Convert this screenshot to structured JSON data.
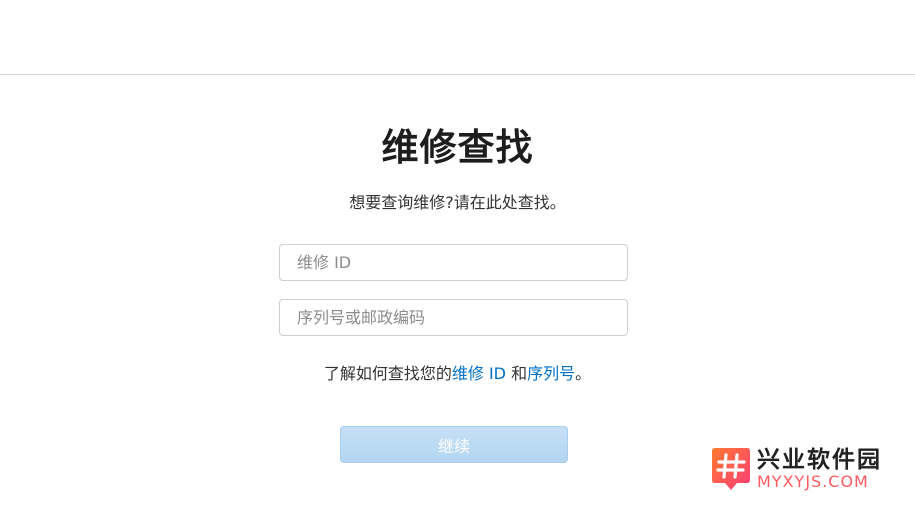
{
  "header": {},
  "main": {
    "title": "维修查找",
    "subtitle": "想要查询维修?请在此处查找。",
    "repair_id_field": {
      "placeholder": "维修 ID",
      "value": ""
    },
    "serial_field": {
      "placeholder": "序列号或邮政编码",
      "value": ""
    },
    "help": {
      "prefix": "了解如何查找您的",
      "repair_id_link": "维修 ID",
      "middle": " 和",
      "serial_link": "序列号",
      "suffix": "。"
    },
    "continue_label": "继续"
  },
  "watermark": {
    "name_cn": "兴业软件园",
    "name_en": "MYXYJS.COM",
    "logo_icon": "hash-logo-icon",
    "colors": {
      "brand_start": "#ff6a3d",
      "brand_end": "#ff3c78"
    }
  },
  "colors": {
    "link": "#0070c9",
    "button_disabled": "#b3d5f1",
    "divider": "#d6d6d6"
  }
}
